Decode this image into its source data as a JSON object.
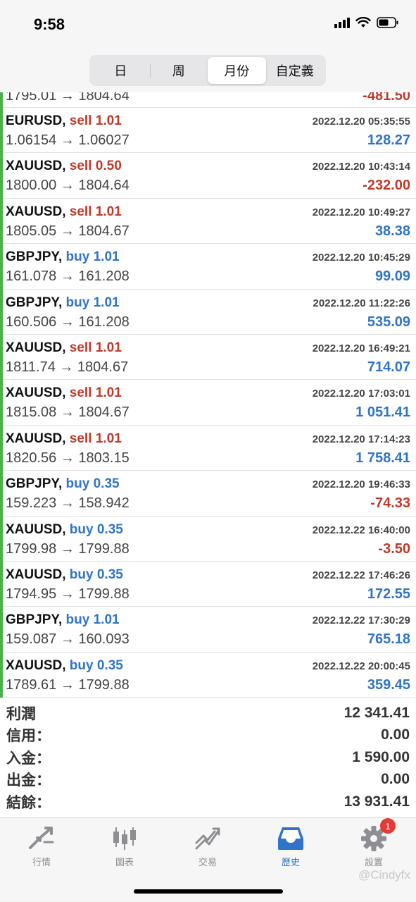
{
  "status_bar": {
    "time": "9:58"
  },
  "period_tabs": [
    {
      "label": "日",
      "active": false
    },
    {
      "label": "周",
      "active": false
    },
    {
      "label": "月份",
      "active": true
    },
    {
      "label": "自定義",
      "active": false
    }
  ],
  "trades": [
    {
      "symbol": "",
      "side": "",
      "volume": "",
      "time": "",
      "price": "1795.01 → 1804.64",
      "profit": "-481.50",
      "profit_sign": "neg"
    },
    {
      "symbol": "EURUSD,",
      "side": "sell",
      "volume": "1.01",
      "time": "2022.12.20 05:35:55",
      "price": "1.06154 → 1.06027",
      "profit": "128.27",
      "profit_sign": "pos"
    },
    {
      "symbol": "XAUUSD,",
      "side": "sell",
      "volume": "0.50",
      "time": "2022.12.20 10:43:14",
      "price": "1800.00 → 1804.64",
      "profit": "-232.00",
      "profit_sign": "neg"
    },
    {
      "symbol": "XAUUSD,",
      "side": "sell",
      "volume": "1.01",
      "time": "2022.12.20 10:49:27",
      "price": "1805.05 → 1804.67",
      "profit": "38.38",
      "profit_sign": "pos"
    },
    {
      "symbol": "GBPJPY,",
      "side": "buy",
      "volume": "1.01",
      "time": "2022.12.20 10:45:29",
      "price": "161.078 → 161.208",
      "profit": "99.09",
      "profit_sign": "pos"
    },
    {
      "symbol": "GBPJPY,",
      "side": "buy",
      "volume": "1.01",
      "time": "2022.12.20 11:22:26",
      "price": "160.506 → 161.208",
      "profit": "535.09",
      "profit_sign": "pos"
    },
    {
      "symbol": "XAUUSD,",
      "side": "sell",
      "volume": "1.01",
      "time": "2022.12.20 16:49:21",
      "price": "1811.74 → 1804.67",
      "profit": "714.07",
      "profit_sign": "pos"
    },
    {
      "symbol": "XAUUSD,",
      "side": "sell",
      "volume": "1.01",
      "time": "2022.12.20 17:03:01",
      "price": "1815.08 → 1804.67",
      "profit": "1 051.41",
      "profit_sign": "pos"
    },
    {
      "symbol": "XAUUSD,",
      "side": "sell",
      "volume": "1.01",
      "time": "2022.12.20 17:14:23",
      "price": "1820.56 → 1803.15",
      "profit": "1 758.41",
      "profit_sign": "pos"
    },
    {
      "symbol": "GBPJPY,",
      "side": "buy",
      "volume": "0.35",
      "time": "2022.12.20 19:46:33",
      "price": "159.223 → 158.942",
      "profit": "-74.33",
      "profit_sign": "neg"
    },
    {
      "symbol": "XAUUSD,",
      "side": "buy",
      "volume": "0.35",
      "time": "2022.12.22 16:40:00",
      "price": "1799.98 → 1799.88",
      "profit": "-3.50",
      "profit_sign": "neg"
    },
    {
      "symbol": "XAUUSD,",
      "side": "buy",
      "volume": "0.35",
      "time": "2022.12.22 17:46:26",
      "price": "1794.95 → 1799.88",
      "profit": "172.55",
      "profit_sign": "pos"
    },
    {
      "symbol": "GBPJPY,",
      "side": "buy",
      "volume": "1.01",
      "time": "2022.12.22 17:30:29",
      "price": "159.087 → 160.093",
      "profit": "765.18",
      "profit_sign": "pos"
    },
    {
      "symbol": "XAUUSD,",
      "side": "buy",
      "volume": "0.35",
      "time": "2022.12.22 20:00:45",
      "price": "1789.61 → 1799.88",
      "profit": "359.45",
      "profit_sign": "pos"
    }
  ],
  "summary": [
    {
      "label": "利潤",
      "value": "12 341.41"
    },
    {
      "label": "信用：",
      "value": "0.00"
    },
    {
      "label": "入金：",
      "value": "1 590.00"
    },
    {
      "label": "出金：",
      "value": "0.00"
    },
    {
      "label": "結餘：",
      "value": "13 931.41"
    }
  ],
  "tabbar": {
    "items": [
      {
        "label": "行情",
        "icon": "quotes-arrows-icon"
      },
      {
        "label": "圖表",
        "icon": "candlestick-chart-icon"
      },
      {
        "label": "交易",
        "icon": "trade-trend-icon"
      },
      {
        "label": "歷史",
        "icon": "history-inbox-icon"
      },
      {
        "label": "設置",
        "icon": "settings-gear-icon"
      }
    ],
    "active_index": 3,
    "settings_badge": "1"
  },
  "watermark": "@Cindyfx",
  "colors": {
    "profit_positive": "#2f74c9",
    "profit_negative": "#c0392b",
    "accent": "#2f74c9",
    "row_marker": "#4caf50"
  }
}
